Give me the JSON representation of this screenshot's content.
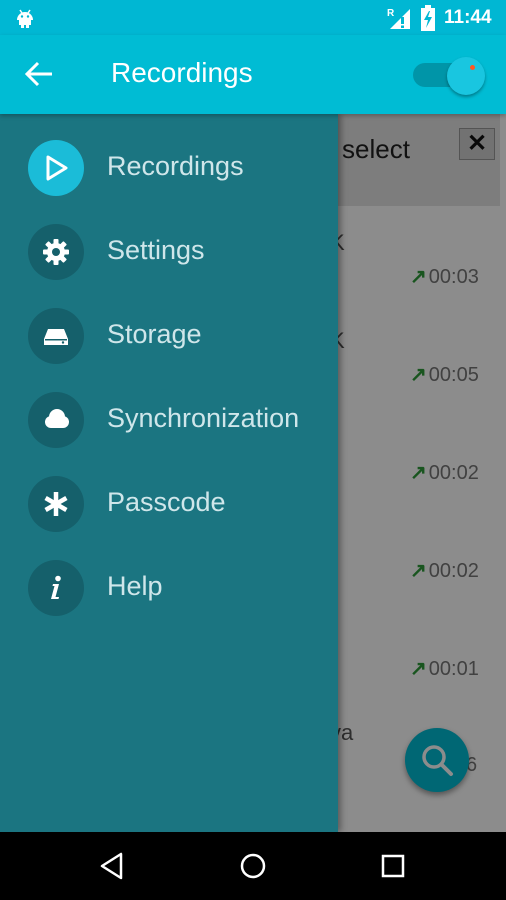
{
  "status_bar": {
    "time": "11:44",
    "icons": [
      "android-icon",
      "signal-icon",
      "battery-icon"
    ]
  },
  "app_bar": {
    "title": "Recordings",
    "icons": [
      "back-arrow-icon"
    ],
    "toggle_on": true
  },
  "background": {
    "select_label": "select",
    "close_label": "✕",
    "rows": [
      {
        "partial": "K",
        "duration": "00:03"
      },
      {
        "partial": "K",
        "duration": "00:05"
      },
      {
        "partial": "",
        "duration": "00:02"
      },
      {
        "partial": "",
        "duration": "00:02"
      },
      {
        "partial": "",
        "duration": "00:01"
      },
      {
        "partial": "ya",
        "duration": "6"
      }
    ],
    "fab_icon": "search-icon"
  },
  "drawer": {
    "items": [
      {
        "label": "Recordings",
        "icon": "play-icon",
        "active": true
      },
      {
        "label": "Settings",
        "icon": "gear-icon",
        "active": false
      },
      {
        "label": "Storage",
        "icon": "storage-drive-icon",
        "active": false
      },
      {
        "label": "Synchronization",
        "icon": "cloud-icon",
        "active": false
      },
      {
        "label": "Passcode",
        "icon": "asterisk-icon",
        "active": false
      },
      {
        "label": "Help",
        "icon": "info-icon",
        "active": false
      }
    ]
  },
  "nav_bar": {
    "icons": [
      "back-triangle-icon",
      "home-circle-icon",
      "recents-square-icon"
    ]
  },
  "colors": {
    "accent": "#00bcd4",
    "drawer": "#1b7581",
    "drawer_icon_circle": "#15606b",
    "active_icon_circle": "#1bbcd8",
    "duration_arrow": "#2e9c3a"
  }
}
